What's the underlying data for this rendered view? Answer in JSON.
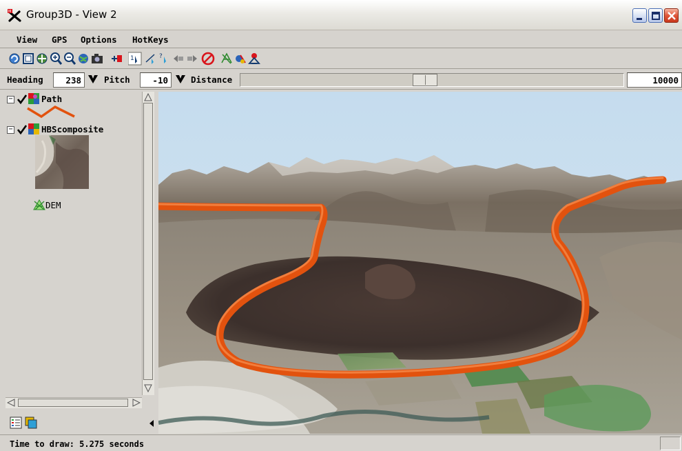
{
  "window": {
    "title": "Group3D - View 2"
  },
  "menu": {
    "items": [
      "View",
      "GPS",
      "Options",
      "HotKeys"
    ]
  },
  "nav": {
    "heading_label": "Heading",
    "heading_value": "238",
    "pitch_label": "Pitch",
    "pitch_value": "-10",
    "distance_label": "Distance",
    "distance_value": "10000",
    "distance_slider_fraction": 0.48
  },
  "layers": [
    {
      "name": "Path",
      "checked": true,
      "icon": "vector-layer-icon"
    },
    {
      "name": "HBScomposite",
      "checked": true,
      "icon": "raster-layer-icon"
    },
    {
      "name": "DEM",
      "icon": "dem-surface-icon"
    }
  ],
  "status": {
    "text": "Time to draw: 5.275 seconds"
  },
  "colors": {
    "path_line": "#e2520e",
    "sky": "#c9deee"
  }
}
